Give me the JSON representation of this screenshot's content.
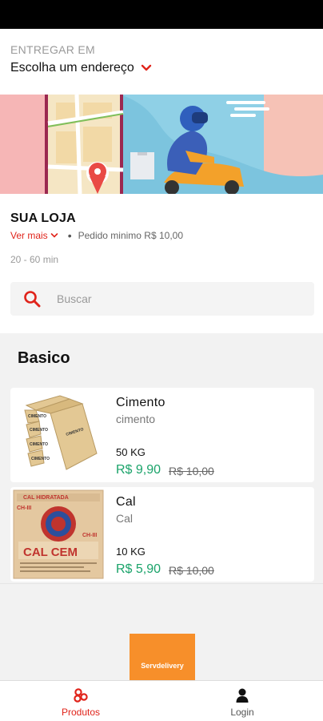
{
  "delivery": {
    "caption": "ENTREGAR EM",
    "address": "Escolha um endereço"
  },
  "store": {
    "name": "SUA LOJA",
    "see_more": "Ver mais",
    "separator": "•",
    "min_order": "Pedido minimo R$ 10,00",
    "eta": "20 - 60 min"
  },
  "search": {
    "placeholder": "Buscar"
  },
  "section": {
    "title": "Basico"
  },
  "products": [
    {
      "name": "Cimento",
      "description": "cimento",
      "unit": "50 KG",
      "price": "R$ 9,90",
      "old_price": "R$ 10,00"
    },
    {
      "name": "Cal",
      "description": "Cal",
      "unit": "10 KG",
      "price": "R$ 5,90",
      "old_price": "R$ 10,00"
    }
  ],
  "footer": {
    "brand": "Servdelivery"
  },
  "nav": {
    "products_label": "Produtos",
    "login_label": "Login"
  },
  "colors": {
    "accent_red": "#e0241b",
    "price_green": "#1aa36a",
    "brand_orange": "#f78f2a"
  },
  "icons": [
    "chevron-down-icon",
    "search-icon",
    "products-icon",
    "user-icon"
  ]
}
